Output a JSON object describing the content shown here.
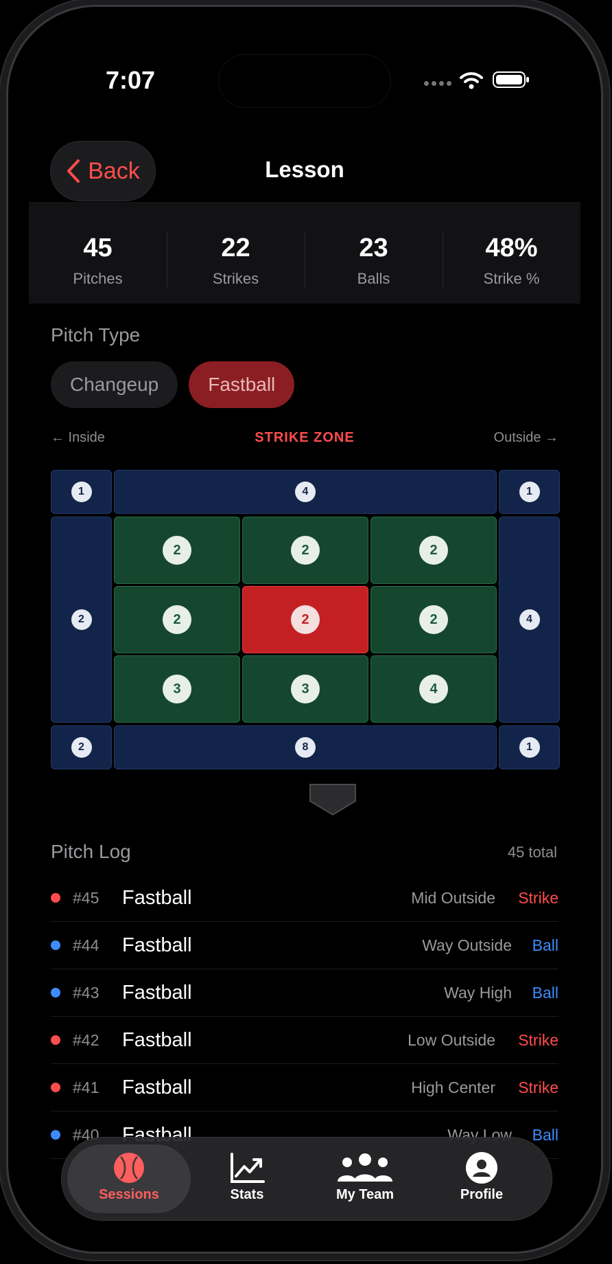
{
  "status": {
    "time": "7:07"
  },
  "header": {
    "back_label": "Back",
    "title": "Lesson"
  },
  "stats": [
    {
      "value": "45",
      "label": "Pitches"
    },
    {
      "value": "22",
      "label": "Strikes"
    },
    {
      "value": "23",
      "label": "Balls"
    },
    {
      "value": "48%",
      "label": "Strike %"
    }
  ],
  "pitch_type": {
    "label": "Pitch Type",
    "options": [
      {
        "label": "Changeup",
        "selected": false
      },
      {
        "label": "Fastball",
        "selected": true
      }
    ]
  },
  "zone": {
    "inside_label": "← Inside",
    "title": "STRIKE ZONE",
    "outside_label": "Outside →",
    "counts": {
      "top_left": "1",
      "top": "4",
      "top_right": "1",
      "left": "2",
      "right": "4",
      "bottom_left": "2",
      "bottom": "8",
      "bottom_right": "1",
      "high_inside": "2",
      "high_center": "2",
      "high_outside": "2",
      "mid_inside": "2",
      "mid_center": "2",
      "mid_outside": "2",
      "low_inside": "3",
      "low_center": "3",
      "low_outside": "4"
    },
    "selected_cell": "mid_center"
  },
  "pitch_log": {
    "title": "Pitch Log",
    "total": "45 total",
    "rows": [
      {
        "num": "#45",
        "type": "Fastball",
        "location": "Mid Outside",
        "result": "Strike"
      },
      {
        "num": "#44",
        "type": "Fastball",
        "location": "Way Outside",
        "result": "Ball"
      },
      {
        "num": "#43",
        "type": "Fastball",
        "location": "Way High",
        "result": "Ball"
      },
      {
        "num": "#42",
        "type": "Fastball",
        "location": "Low Outside",
        "result": "Strike"
      },
      {
        "num": "#41",
        "type": "Fastball",
        "location": "High Center",
        "result": "Strike"
      },
      {
        "num": "#40",
        "type": "Fastball",
        "location": "Way Low",
        "result": "Ball"
      }
    ]
  },
  "colors": {
    "strike": "#ff4d4d",
    "ball": "#3d8bff",
    "accent": "#ff4d4d"
  },
  "tabs": [
    {
      "label": "Sessions",
      "icon": "baseball-icon",
      "active": true
    },
    {
      "label": "Stats",
      "icon": "chart-icon",
      "active": false
    },
    {
      "label": "My Team",
      "icon": "team-icon",
      "active": false
    },
    {
      "label": "Profile",
      "icon": "person-icon",
      "active": false
    }
  ]
}
